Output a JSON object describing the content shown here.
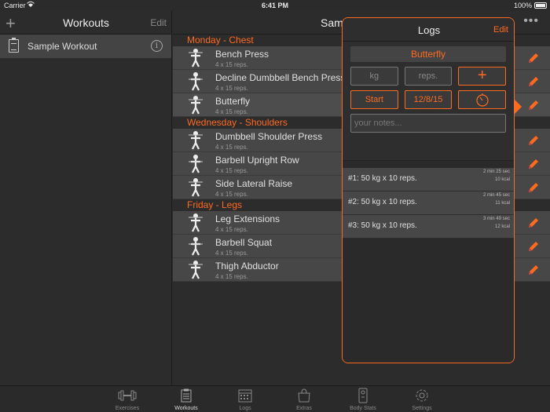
{
  "status": {
    "carrier": "Carrier",
    "time": "6:41 PM",
    "battery": "100%"
  },
  "left": {
    "title": "Workouts",
    "edit_label": "Edit",
    "add_label": "+",
    "items": [
      {
        "label": "Sample Workout"
      }
    ]
  },
  "right": {
    "title": "Sam",
    "more_label": "•••"
  },
  "sections": [
    {
      "title": "Monday - Chest",
      "exercises": [
        {
          "name": "Bench Press",
          "reps": "4 x 15 reps."
        },
        {
          "name": "Decline Dumbbell Bench Press",
          "reps": "4 x 15 reps."
        },
        {
          "name": "Butterfly",
          "reps": "4 x 15 reps."
        }
      ]
    },
    {
      "title": "Wednesday - Shoulders",
      "exercises": [
        {
          "name": "Dumbbell Shoulder Press",
          "reps": "4 x 15 reps."
        },
        {
          "name": "Barbell Upright Row",
          "reps": "4 x 15 reps."
        },
        {
          "name": "Side Lateral Raise",
          "reps": "4 x 15 reps."
        }
      ]
    },
    {
      "title": "Friday - Legs",
      "exercises": [
        {
          "name": "Leg Extensions",
          "reps": "4 x 15 reps."
        },
        {
          "name": "Barbell Squat",
          "reps": "4 x 15 reps."
        },
        {
          "name": "Thigh Abductor",
          "reps": "4 x 15 reps."
        }
      ]
    }
  ],
  "logs": {
    "title": "Logs",
    "edit_label": "Edit",
    "exercise": "Butterfly",
    "kg_placeholder": "kg",
    "reps_placeholder": "reps.",
    "add_label": "+",
    "start_label": "Start",
    "date_label": "12/8/15",
    "notes_placeholder": "your notes...",
    "entries": [
      {
        "text": "#1: 50 kg x 10 reps.",
        "duration": "2 min 25 sec",
        "kcal": "10 kcal"
      },
      {
        "text": "#2: 50 kg x 10 reps.",
        "duration": "2 min 45 sec",
        "kcal": "11 kcal"
      },
      {
        "text": "#3: 50 kg x 10 reps.",
        "duration": "3 min 49 sec",
        "kcal": "12 kcal"
      }
    ]
  },
  "tabs": [
    {
      "label": "Exercises",
      "icon": "dumbbell-icon"
    },
    {
      "label": "Workouts",
      "icon": "clipboard-icon"
    },
    {
      "label": "Logs",
      "icon": "calendar-icon"
    },
    {
      "label": "Extras",
      "icon": "bag-icon"
    },
    {
      "label": "Body Stats",
      "icon": "scale-icon"
    },
    {
      "label": "Settings",
      "icon": "gear-icon"
    }
  ],
  "colors": {
    "accent": "#ff6a1f",
    "background": "#2b2b2b",
    "row": "#474747"
  }
}
